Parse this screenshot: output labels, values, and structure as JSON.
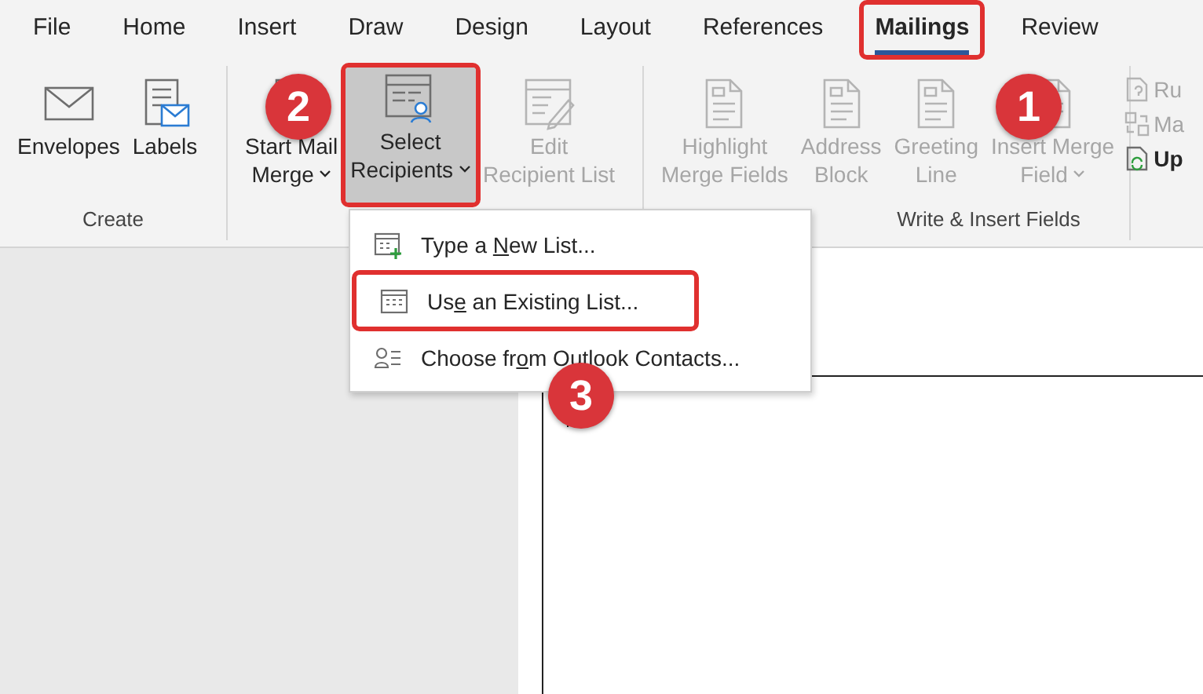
{
  "tabs": [
    {
      "label": "File",
      "selected": false
    },
    {
      "label": "Home",
      "selected": false
    },
    {
      "label": "Insert",
      "selected": false
    },
    {
      "label": "Draw",
      "selected": false
    },
    {
      "label": "Design",
      "selected": false
    },
    {
      "label": "Layout",
      "selected": false
    },
    {
      "label": "References",
      "selected": false
    },
    {
      "label": "Mailings",
      "selected": true,
      "annotated": true
    },
    {
      "label": "Review",
      "selected": false
    }
  ],
  "ribbon_groups": [
    {
      "label": "Create",
      "items": [
        {
          "kind": "envelope",
          "lines": [
            "Envelopes"
          ],
          "dropdown": false,
          "disabled": false,
          "selected": false
        },
        {
          "kind": "labels",
          "lines": [
            "Labels"
          ],
          "dropdown": false,
          "disabled": false,
          "selected": false
        }
      ]
    },
    {
      "items": [
        {
          "kind": "merge",
          "lines": [
            "Start Mail",
            "Merge"
          ],
          "dropdown": true,
          "disabled": false,
          "selected": false
        },
        {
          "kind": "recipients",
          "lines": [
            "Select",
            "Recipients"
          ],
          "dropdown": true,
          "disabled": false,
          "selected": true,
          "annotated": true
        },
        {
          "kind": "edit",
          "lines": [
            "Edit",
            "Recipient List"
          ],
          "dropdown": false,
          "disabled": true,
          "selected": false
        }
      ]
    },
    {
      "label": "Write & Insert Fields",
      "items": [
        {
          "kind": "document",
          "lines": [
            "Highlight",
            "Merge Fields"
          ],
          "dropdown": false,
          "disabled": true,
          "selected": false
        },
        {
          "kind": "document",
          "lines": [
            "Address",
            "Block"
          ],
          "dropdown": false,
          "disabled": true,
          "selected": false
        },
        {
          "kind": "document",
          "lines": [
            "Greeting",
            "Line"
          ],
          "dropdown": false,
          "disabled": true,
          "selected": false
        },
        {
          "kind": "document",
          "lines": [
            "Insert Merge",
            "Field"
          ],
          "dropdown": true,
          "disabled": true,
          "selected": false
        }
      ],
      "small_items": [
        {
          "kind": "rules",
          "label": "Ru",
          "disabled": true
        },
        {
          "kind": "match",
          "label": "Ma",
          "disabled": true
        },
        {
          "kind": "update",
          "label": "Up",
          "disabled": false
        }
      ]
    }
  ],
  "menu": [
    {
      "kind": "new-list",
      "before": "Type a ",
      "key": "N",
      "after": "ew List..."
    },
    {
      "kind": "existing-list",
      "before": "Us",
      "key": "e",
      "after": " an Existing List...",
      "annotated": true
    },
    {
      "kind": "contacts",
      "before": "Choose fr",
      "key": "o",
      "after": "m Outlook Contacts..."
    }
  ],
  "badges": [
    "1",
    "2",
    "3"
  ]
}
